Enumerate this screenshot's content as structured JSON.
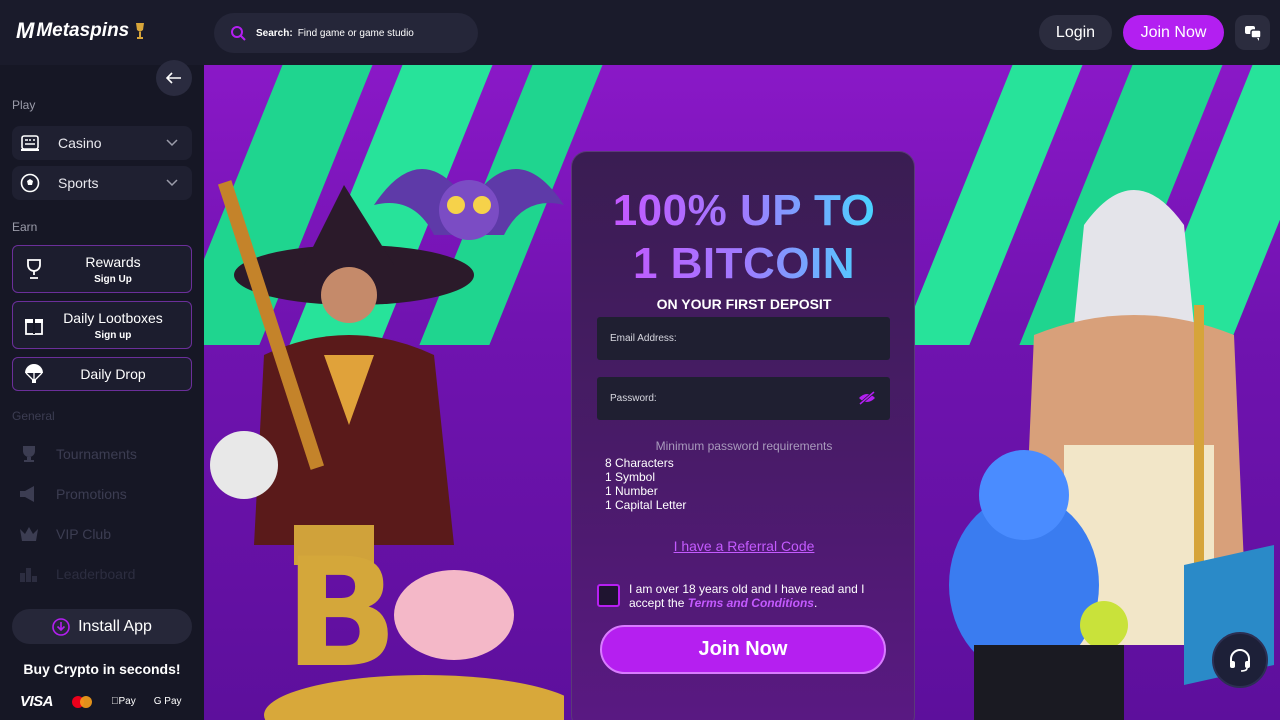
{
  "header": {
    "logo_mark": "M",
    "logo_text": "Metaspins",
    "search": {
      "label": "Search:",
      "placeholder": "Find game or game studio"
    },
    "login_label": "Login",
    "join_label": "Join Now"
  },
  "sidebar": {
    "play_label": "Play",
    "play_items": [
      {
        "label": "Casino",
        "icon": "casino-icon"
      },
      {
        "label": "Sports",
        "icon": "soccer-ball-icon"
      }
    ],
    "earn_label": "Earn",
    "earn_items": [
      {
        "title": "Rewards",
        "sub": "Sign Up",
        "icon": "trophy-icon"
      },
      {
        "title": "Daily Lootboxes",
        "sub": "Sign up",
        "icon": "gift-icon"
      },
      {
        "title": "Daily Drop",
        "sub": "",
        "icon": "parachute-icon"
      }
    ],
    "general_label": "General",
    "general_items": [
      {
        "label": "Tournaments"
      },
      {
        "label": "Promotions"
      },
      {
        "label": "VIP Club"
      },
      {
        "label": "Leaderboard"
      }
    ],
    "install_label": "Install App",
    "buy_crypto": "Buy Crypto in seconds!",
    "payments": {
      "visa": "VISA",
      "apple": "Pay",
      "google": "G Pay"
    }
  },
  "promo": {
    "headline_1": "100% UP TO",
    "headline_2": "1 BITCOIN",
    "subhead": "ON YOUR FIRST DEPOSIT",
    "email_placeholder": "Email Address:",
    "password_placeholder": "Password:",
    "pw_req_title": "Minimum password requirements",
    "pw_reqs": [
      "8 Characters",
      "1 Symbol",
      "1 Number",
      "1 Capital Letter"
    ],
    "referral": "I have a Referral Code",
    "terms_prefix": "I am over 18 years old and I have read and I accept the ",
    "terms_link": "Terms and Conditions",
    "terms_suffix": ".",
    "join_label": "Join Now"
  },
  "colors": {
    "accent": "#b31ff1",
    "sidebar_bg": "#161725",
    "header_bg": "#1a1b2b",
    "banner_purple": "#7a14bb",
    "banner_green": "#2de08a"
  }
}
